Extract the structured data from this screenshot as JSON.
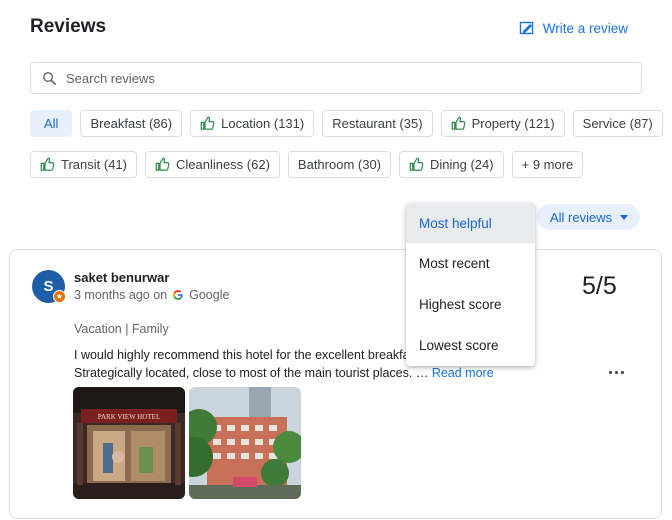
{
  "header": {
    "title": "Reviews",
    "write_review_label": "Write a review"
  },
  "search": {
    "placeholder": "Search reviews",
    "value": ""
  },
  "filters": {
    "row1": [
      {
        "label": "All",
        "active": true,
        "icon": null
      },
      {
        "label": "Breakfast (86)",
        "active": false,
        "icon": null
      },
      {
        "label": "Location (131)",
        "active": false,
        "icon": "thumbs-up-icon"
      },
      {
        "label": "Restaurant (35)",
        "active": false,
        "icon": null
      },
      {
        "label": "Property (121)",
        "active": false,
        "icon": "thumbs-up-icon"
      },
      {
        "label": "Service (87)",
        "active": false,
        "icon": null
      }
    ],
    "row2": [
      {
        "label": "Transit (41)",
        "active": false,
        "icon": "thumbs-up-icon"
      },
      {
        "label": "Cleanliness (62)",
        "active": false,
        "icon": "thumbs-up-icon"
      },
      {
        "label": "Bathroom (30)",
        "active": false,
        "icon": null
      },
      {
        "label": "Dining (24)",
        "active": false,
        "icon": "thumbs-up-icon"
      },
      {
        "label": "+ 9 more",
        "active": false,
        "icon": null
      }
    ]
  },
  "sort": {
    "label": "All reviews",
    "options": [
      "Most helpful",
      "Most recent",
      "Highest score",
      "Lowest score"
    ],
    "selected": "Most helpful"
  },
  "review": {
    "avatar_letter": "S",
    "author": "saket benurwar",
    "time": "3 months ago on",
    "source": "Google",
    "score": "5/5",
    "trip": "Vacation | Family",
    "text_line1": "I would highly recommend this hotel for the excellent breakfa",
    "text_line2": "Strategically located, close to most of the main tourist places. …",
    "read_more": "Read more",
    "photos": [
      "hotel-lobby-photo",
      "hotel-exterior-photo"
    ],
    "photo1_sign": "PARK VIEW HOTEL"
  },
  "colors": {
    "accent": "#1a73e8",
    "chip_active_bg": "#e8f0fe",
    "thumb_green": "#188038",
    "avatar_bg": "#1d5ea6",
    "badge_orange": "#e8710a"
  }
}
